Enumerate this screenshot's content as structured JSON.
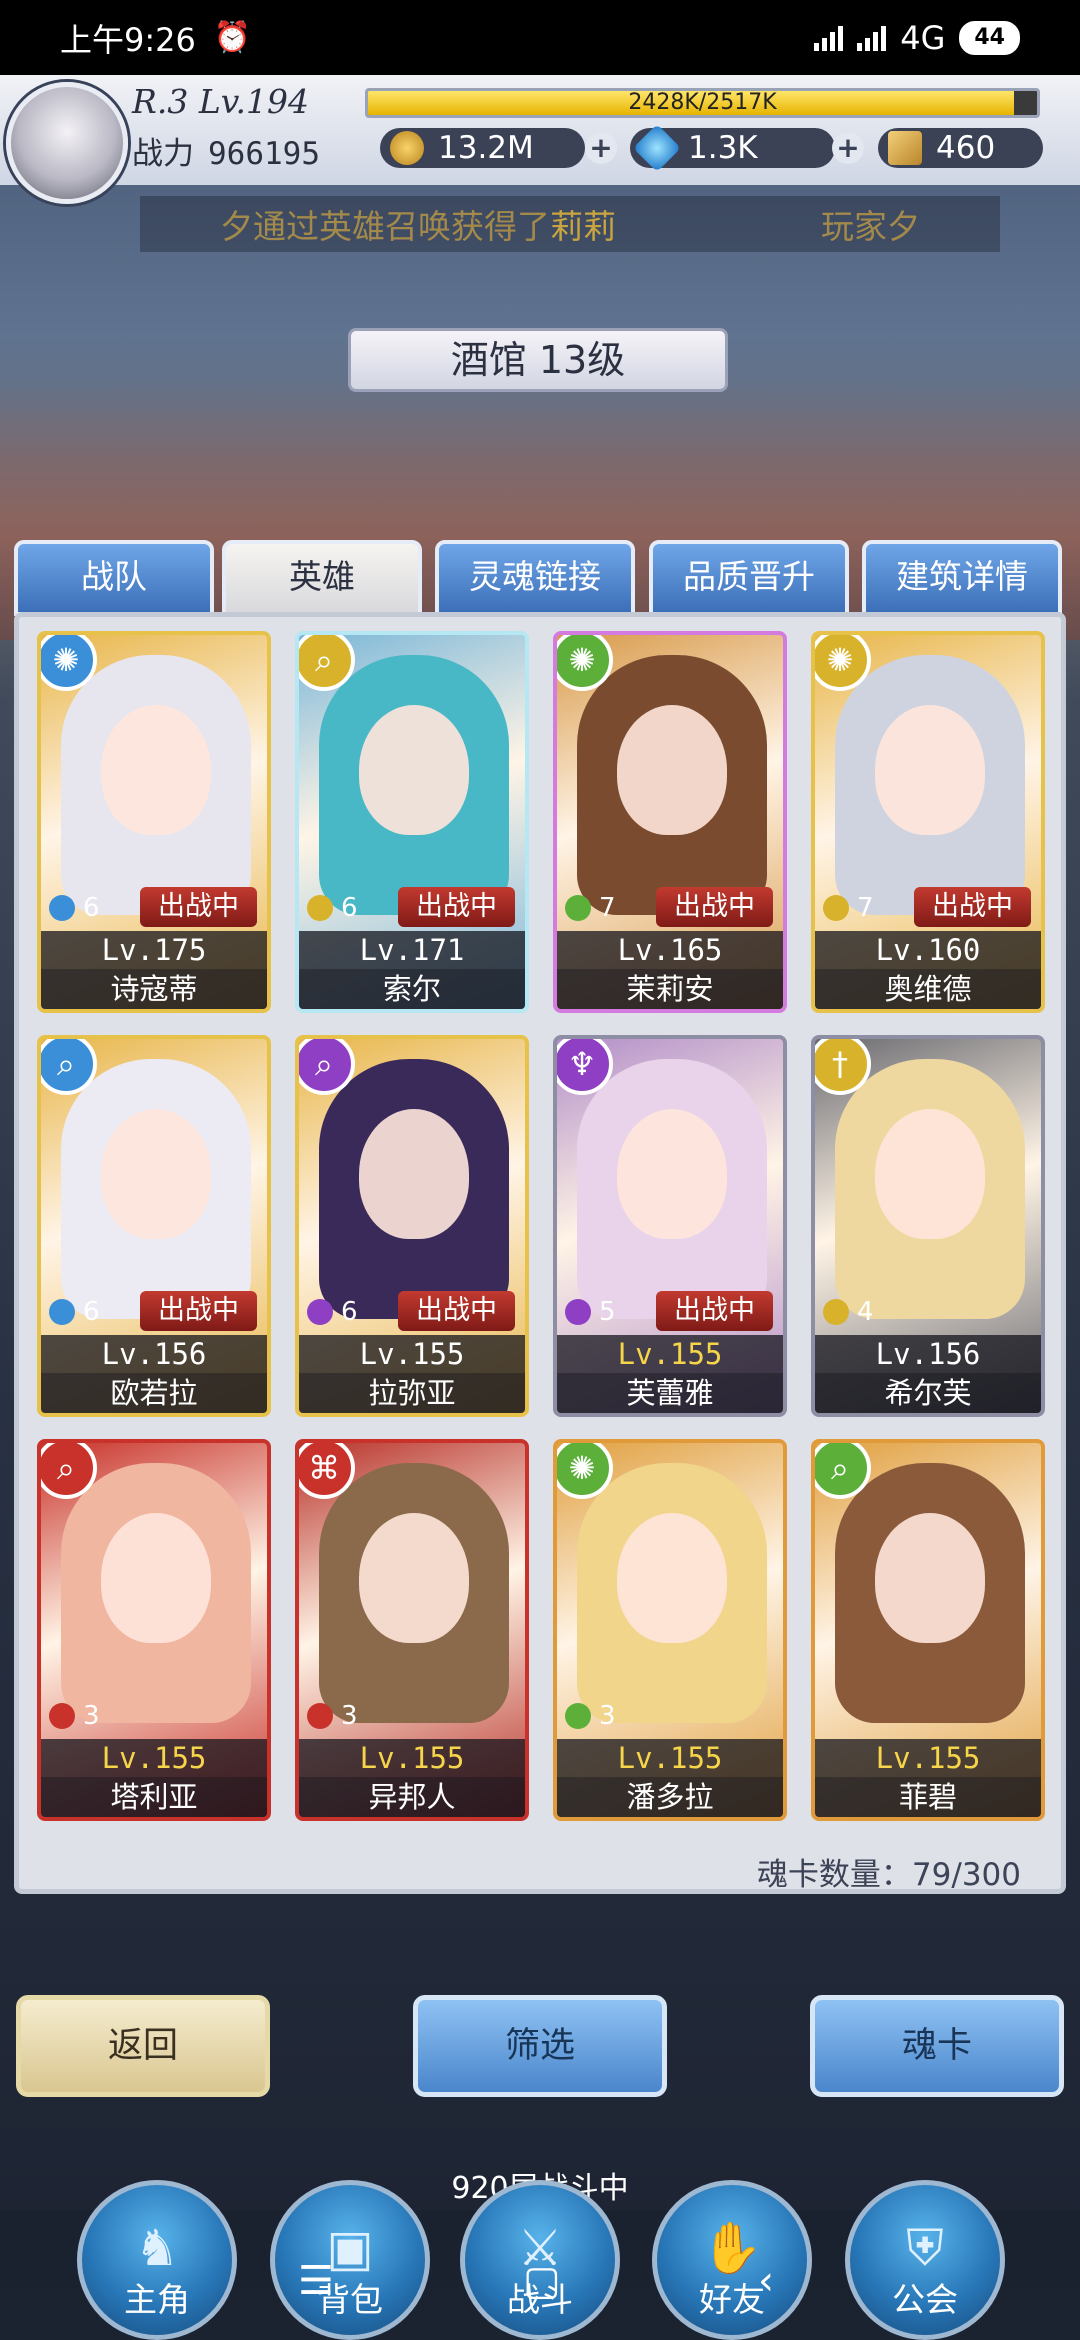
{
  "status_bar": {
    "time": "上午9:26",
    "network": "4G",
    "battery": "44"
  },
  "player": {
    "rank_level": "R.3 Lv.194",
    "exp_text": "2428K/2517K",
    "exp_fraction": 0.965,
    "power_label": "战力",
    "power_value": "966195",
    "gold": "13.2M",
    "diamond": "1.3K",
    "ticket": "460"
  },
  "ticker": {
    "prefix": "夕通过英雄召唤获得了",
    "hero": "莉莉",
    "right": "玩家夕"
  },
  "building_title": "酒馆 13级",
  "tabs": [
    {
      "label": "战队",
      "active": false
    },
    {
      "label": "英雄",
      "active": true
    },
    {
      "label": "灵魂链接",
      "active": false
    },
    {
      "label": "品质晋升",
      "active": false
    },
    {
      "label": "建筑详情",
      "active": false
    }
  ],
  "heroes": [
    {
      "name": "诗寇蒂",
      "level": "Lv.175",
      "stars": "6",
      "in_battle": "出战中",
      "element": "wind",
      "elem_color": "#3a8fd8",
      "frame": "#e7c24a",
      "hair": "#e7e6ee",
      "bg": "#e8b64a",
      "gold_level": false
    },
    {
      "name": "索尔",
      "level": "Lv.171",
      "stars": "6",
      "in_battle": "出战中",
      "element": "magnify",
      "elem_color": "#d7b22a",
      "frame": "#b5e8f3",
      "hair": "#49b8c6",
      "bg": "#7bb7d8",
      "gold_level": false
    },
    {
      "name": "茉莉安",
      "level": "Lv.165",
      "stars": "7",
      "in_battle": "出战中",
      "element": "wind",
      "elem_color": "#5cb03a",
      "frame": "#d47be0",
      "hair": "#7a4b2e",
      "bg": "#d89a4a",
      "gold_level": false
    },
    {
      "name": "奥维德",
      "level": "Lv.160",
      "stars": "7",
      "in_battle": "出战中",
      "element": "wind",
      "elem_color": "#d7b22a",
      "frame": "#e7c24a",
      "hair": "#cfd3df",
      "bg": "#e8b64a",
      "gold_level": false
    },
    {
      "name": "欧若拉",
      "level": "Lv.156",
      "stars": "6",
      "in_battle": "出战中",
      "element": "magnify",
      "elem_color": "#3a8fd8",
      "frame": "#e7c24a",
      "hair": "#eceaf2",
      "bg": "#e8b64a",
      "gold_level": false
    },
    {
      "name": "拉弥亚",
      "level": "Lv.155",
      "stars": "6",
      "in_battle": "出战中",
      "element": "magnify",
      "elem_color": "#8e3fc4",
      "frame": "#e7c24a",
      "hair": "#3a2a5a",
      "bg": "#e8b64a",
      "gold_level": false
    },
    {
      "name": "芙蕾雅",
      "level": "Lv.155",
      "stars": "5",
      "in_battle": "出战中",
      "element": "crest",
      "elem_color": "#8e3fc4",
      "frame": "#8d8ea3",
      "hair": "#e8d3ea",
      "bg": "#b28ec8",
      "gold_level": true
    },
    {
      "name": "希尔芙",
      "level": "Lv.156",
      "stars": "4",
      "in_battle": "",
      "element": "sword",
      "elem_color": "#d7b22a",
      "frame": "#8d8ea3",
      "hair": "#efd8a0",
      "bg": "#6a6a70",
      "gold_level": false
    },
    {
      "name": "塔利亚",
      "level": "Lv.155",
      "stars": "3",
      "in_battle": "",
      "element": "magnify",
      "elem_color": "#c8322a",
      "frame": "#c8322a",
      "hair": "#f0b6a0",
      "bg": "#c8322a",
      "gold_level": true
    },
    {
      "name": "异邦人",
      "level": "Lv.155",
      "stars": "3",
      "in_battle": "",
      "element": "rune",
      "elem_color": "#c8322a",
      "frame": "#c8322a",
      "hair": "#8a6a4a",
      "bg": "#b8322a",
      "gold_level": true
    },
    {
      "name": "潘多拉",
      "level": "Lv.155",
      "stars": "3",
      "in_battle": "",
      "element": "wind",
      "elem_color": "#5cb03a",
      "frame": "#e09a3a",
      "hair": "#f0d58a",
      "bg": "#e0a040",
      "gold_level": true
    },
    {
      "name": "菲碧",
      "level": "Lv.155",
      "stars": "",
      "in_battle": "",
      "element": "magnify",
      "elem_color": "#5cb03a",
      "frame": "#e09a3a",
      "hair": "#8a5a3a",
      "bg": "#e0a040",
      "gold_level": true
    }
  ],
  "soul_count": "魂卡数量：79/300",
  "buttons": {
    "back": "返回",
    "filter": "筛选",
    "soul_card": "魂卡"
  },
  "floor_status": "920层战斗中",
  "nav": [
    {
      "label": "主角",
      "icon": "hero-helmet-icon"
    },
    {
      "label": "背包",
      "icon": "backpack-icon"
    },
    {
      "label": "战斗",
      "icon": "crossed-swords-icon"
    },
    {
      "label": "好友",
      "icon": "handshake-icon"
    },
    {
      "label": "公会",
      "icon": "guild-crest-icon"
    }
  ]
}
